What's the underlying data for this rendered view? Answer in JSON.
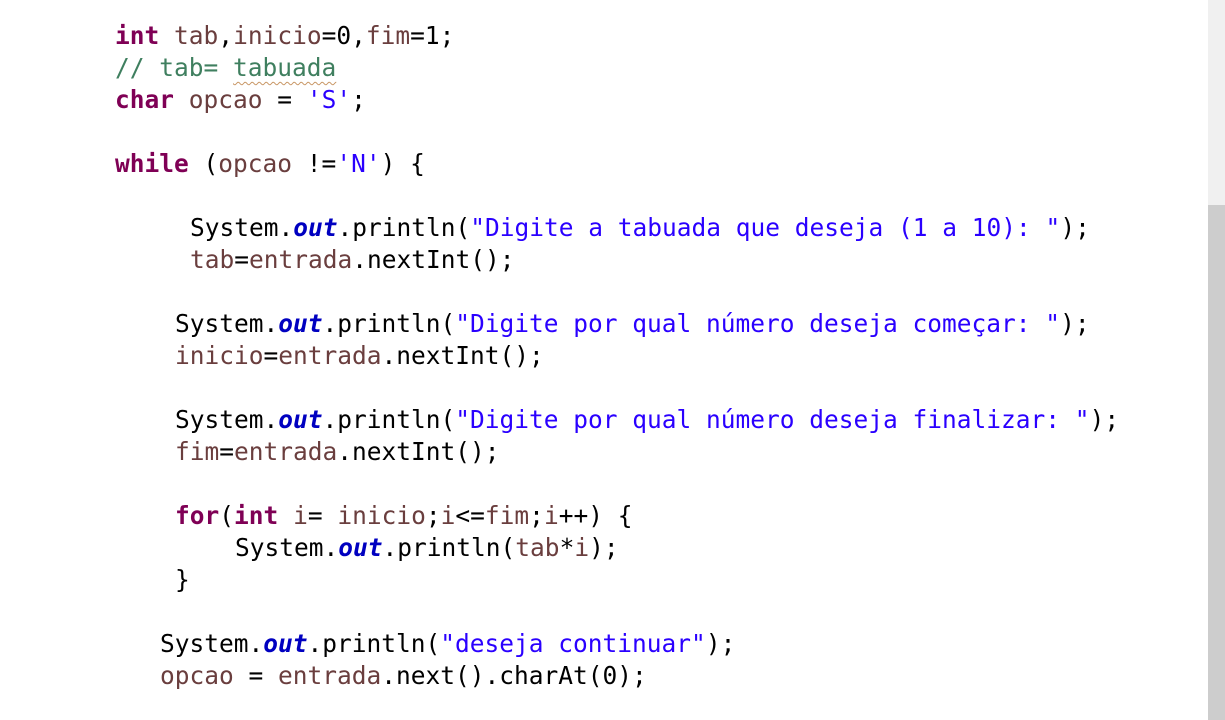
{
  "editor": {
    "lines": [
      {
        "tokens": [
          {
            "t": "int",
            "c": "kw"
          },
          {
            "t": " ",
            "c": ""
          },
          {
            "t": "tab",
            "c": "var"
          },
          {
            "t": ",",
            "c": ""
          },
          {
            "t": "inicio",
            "c": "var"
          },
          {
            "t": "=0,",
            "c": ""
          },
          {
            "t": "fim",
            "c": "var"
          },
          {
            "t": "=1;",
            "c": ""
          }
        ]
      },
      {
        "tokens": [
          {
            "t": "// tab= ",
            "c": "cmt"
          },
          {
            "t": "tabuada",
            "c": "cmt squiggle"
          }
        ]
      },
      {
        "tokens": [
          {
            "t": "char",
            "c": "kw"
          },
          {
            "t": " ",
            "c": ""
          },
          {
            "t": "opcao",
            "c": "var"
          },
          {
            "t": " = ",
            "c": ""
          },
          {
            "t": "'S'",
            "c": "str"
          },
          {
            "t": ";",
            "c": ""
          }
        ]
      },
      {
        "tokens": [
          {
            "t": "while",
            "c": "kw"
          },
          {
            "t": " (",
            "c": ""
          },
          {
            "t": "opcao",
            "c": "var"
          },
          {
            "t": " !=",
            "c": ""
          },
          {
            "t": "'N'",
            "c": "str"
          },
          {
            "t": ") {",
            "c": ""
          }
        ]
      },
      {
        "tokens": [
          {
            "t": "System.",
            "c": ""
          },
          {
            "t": "out",
            "c": "fld"
          },
          {
            "t": ".println(",
            "c": ""
          },
          {
            "t": "\"Digite a tabuada que deseja (1 a 10): \"",
            "c": "str"
          },
          {
            "t": ");",
            "c": ""
          }
        ]
      },
      {
        "tokens": [
          {
            "t": "tab",
            "c": "var"
          },
          {
            "t": "=",
            "c": ""
          },
          {
            "t": "entrada",
            "c": "var"
          },
          {
            "t": ".nextInt();",
            "c": ""
          }
        ]
      },
      {
        "tokens": [
          {
            "t": "System.",
            "c": ""
          },
          {
            "t": "out",
            "c": "fld"
          },
          {
            "t": ".println(",
            "c": ""
          },
          {
            "t": "\"Digite por qual número deseja começar: \"",
            "c": "str"
          },
          {
            "t": ");",
            "c": ""
          }
        ]
      },
      {
        "tokens": [
          {
            "t": "inicio",
            "c": "var"
          },
          {
            "t": "=",
            "c": ""
          },
          {
            "t": "entrada",
            "c": "var"
          },
          {
            "t": ".nextInt();",
            "c": ""
          }
        ]
      },
      {
        "tokens": [
          {
            "t": "System.",
            "c": ""
          },
          {
            "t": "out",
            "c": "fld"
          },
          {
            "t": ".println(",
            "c": ""
          },
          {
            "t": "\"Digite por qual número deseja finalizar: \"",
            "c": "str"
          },
          {
            "t": ");",
            "c": ""
          }
        ]
      },
      {
        "tokens": [
          {
            "t": "fim",
            "c": "var"
          },
          {
            "t": "=",
            "c": ""
          },
          {
            "t": "entrada",
            "c": "var"
          },
          {
            "t": ".nextInt();",
            "c": ""
          }
        ]
      },
      {
        "tokens": [
          {
            "t": "for",
            "c": "kw"
          },
          {
            "t": "(",
            "c": ""
          },
          {
            "t": "int",
            "c": "kw"
          },
          {
            "t": " ",
            "c": ""
          },
          {
            "t": "i",
            "c": "var"
          },
          {
            "t": "= ",
            "c": ""
          },
          {
            "t": "inicio",
            "c": "var"
          },
          {
            "t": ";",
            "c": ""
          },
          {
            "t": "i",
            "c": "var"
          },
          {
            "t": "<=",
            "c": ""
          },
          {
            "t": "fim",
            "c": "var"
          },
          {
            "t": ";",
            "c": ""
          },
          {
            "t": "i",
            "c": "var"
          },
          {
            "t": "++) {",
            "c": ""
          }
        ]
      },
      {
        "tokens": [
          {
            "t": "System.",
            "c": ""
          },
          {
            "t": "out",
            "c": "fld"
          },
          {
            "t": ".println(",
            "c": ""
          },
          {
            "t": "tab",
            "c": "var"
          },
          {
            "t": "*",
            "c": ""
          },
          {
            "t": "i",
            "c": "var"
          },
          {
            "t": ");",
            "c": ""
          }
        ]
      },
      {
        "tokens": [
          {
            "t": "}",
            "c": ""
          }
        ]
      },
      {
        "tokens": [
          {
            "t": "System.",
            "c": ""
          },
          {
            "t": "out",
            "c": "fld"
          },
          {
            "t": ".println(",
            "c": ""
          },
          {
            "t": "\"deseja continuar\"",
            "c": "str"
          },
          {
            "t": ");",
            "c": ""
          }
        ]
      },
      {
        "tokens": [
          {
            "t": "opcao",
            "c": "var"
          },
          {
            "t": " = ",
            "c": ""
          },
          {
            "t": "entrada",
            "c": "var"
          },
          {
            "t": ".next().charAt(0);",
            "c": ""
          }
        ]
      }
    ]
  },
  "colors": {
    "keyword": "#7f0055",
    "variable": "#6a3e3e",
    "string": "#2a00ff",
    "static_field": "#0000c0",
    "comment": "#3f7f5f",
    "background": "#ffffff"
  }
}
